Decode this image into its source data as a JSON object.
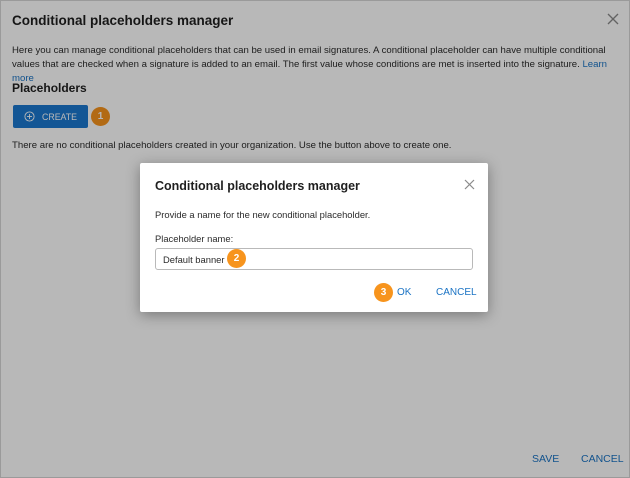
{
  "outer_dialog": {
    "title": "Conditional placeholders manager",
    "description": "Here you can manage conditional placeholders that can be used in email signatures. A conditional placeholder can have multiple conditional values that are checked when a signature is added to an email. The first value whose conditions are met is inserted into the signature.",
    "learn_more": "Learn more",
    "section_title": "Placeholders",
    "create_label": "CREATE",
    "empty_text": "There are no conditional placeholders created in your organization. Use the button above to create one.",
    "save_label": "SAVE",
    "cancel_label": "CANCEL",
    "close_icon": "close-icon",
    "create_icon": "plus-circle-icon"
  },
  "modal": {
    "title": "Conditional placeholders manager",
    "description": "Provide a name for the new conditional placeholder.",
    "field_label": "Placeholder name:",
    "field_value": "Default banner",
    "ok_label": "OK",
    "cancel_label": "CANCEL",
    "close_icon": "close-icon"
  },
  "badges": [
    "1",
    "2",
    "3"
  ],
  "colors": {
    "accent": "#1b78cf",
    "link": "#1a73c4",
    "badge": "#f7941d",
    "overlay": "rgba(0,0,0,0.28)"
  }
}
